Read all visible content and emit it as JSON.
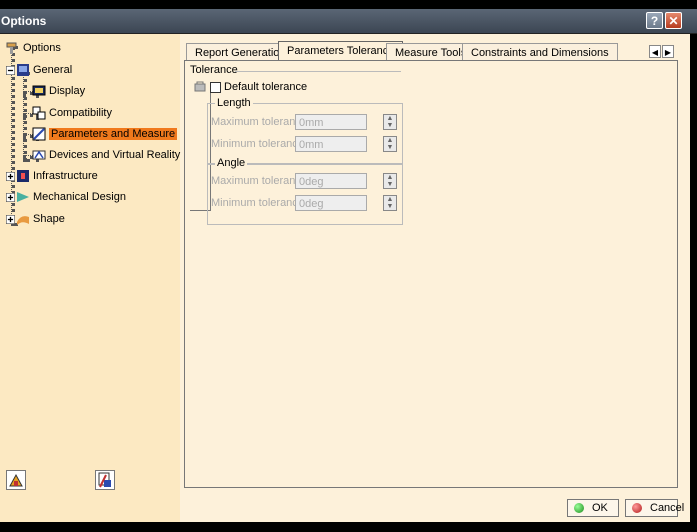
{
  "window": {
    "title": "Options",
    "help_symbol": "?",
    "close_symbol": "✕"
  },
  "tree": {
    "root": {
      "label": "Options"
    },
    "items": [
      {
        "label": "General"
      },
      {
        "label": "Display"
      },
      {
        "label": "Compatibility"
      },
      {
        "label": "Parameters and Measure",
        "selected": true
      },
      {
        "label": "Devices and Virtual Reality"
      },
      {
        "label": "Infrastructure"
      },
      {
        "label": "Mechanical Design"
      },
      {
        "label": "Shape"
      }
    ]
  },
  "tabs": [
    {
      "label": "Report Generation"
    },
    {
      "label": "Parameters Tolerance",
      "active": true
    },
    {
      "label": "Measure Tools"
    },
    {
      "label": "Constraints and Dimensions"
    }
  ],
  "tolerance": {
    "title": "Tolerance",
    "default_label": "Default tolerance",
    "default_checked": false,
    "length": {
      "title": "Length",
      "max_label": "Maximum tolerance",
      "max_value": "0mm",
      "min_label": "Minimum tolerance",
      "min_value": "0mm"
    },
    "angle": {
      "title": "Angle",
      "max_label": "Maximum tolerance",
      "max_value": "0deg",
      "min_label": "Minimum tolerance",
      "min_value": "0deg"
    }
  },
  "footer": {
    "ok_label": "OK",
    "cancel_label": "Cancel"
  },
  "colors": {
    "selected": "#f0791c",
    "panel": "#fdf1da",
    "tree": "#fce9c2"
  }
}
